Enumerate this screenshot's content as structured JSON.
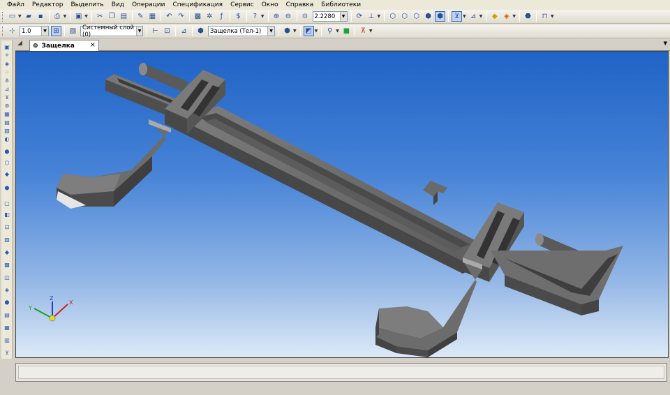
{
  "menu": {
    "items": [
      {
        "label": "Файл"
      },
      {
        "label": "Редактор"
      },
      {
        "label": "Выделить"
      },
      {
        "label": "Вид"
      },
      {
        "label": "Операции"
      },
      {
        "label": "Спецификация"
      },
      {
        "label": "Сервис"
      },
      {
        "label": "Окно"
      },
      {
        "label": "Справка"
      },
      {
        "label": "Библиотеки"
      }
    ]
  },
  "toolbar": {
    "zoom_value": "2.2280",
    "step_value": "1.0",
    "layer_value": "Системный слой (0)",
    "part_value": "Защелка (Тел-1)"
  },
  "document": {
    "tab_label": "Защелка",
    "close_glyph": "×"
  },
  "viewport": {
    "background_top": "#1f63c6",
    "background_bottom": "#dde9f7",
    "part_color": "#6a6a6a"
  },
  "axes": {
    "x_label": "X",
    "y_label": "Y",
    "z_label": "Z",
    "x_color": "#d02020",
    "y_color": "#20a020",
    "z_color": "#2040d0"
  }
}
